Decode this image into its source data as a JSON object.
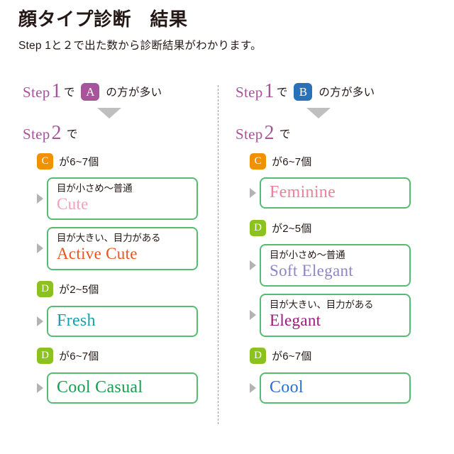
{
  "header": {
    "title": "顔タイプ診断　結果",
    "subtitle": "Step 1と２で出た数から診断結果がわかります。"
  },
  "colors": {
    "step_label": "#a8549a",
    "badge_a": "#a8549a",
    "badge_b": "#2a72b8",
    "badge_c": "#f29100",
    "badge_d": "#8cc220",
    "box_border": "#57bb72",
    "divider": "#9a9a9a",
    "arrow": "#bfbfbf",
    "marker": "#b3b3b3",
    "text": "#231815"
  },
  "columns": [
    {
      "id": "left",
      "step1": {
        "step_word": "Step",
        "step_num": "1",
        "de": "で",
        "badge": "A",
        "tail": "の方が多い"
      },
      "arrow_icon": "triangle-down-icon",
      "step2": {
        "step_word": "Step",
        "step_num": "2",
        "de": "で"
      },
      "groups": [
        {
          "badge": "C",
          "badge_kind": "c",
          "count_text": "が6~7個",
          "results": [
            {
              "note": "目が小さめ〜普通",
              "title": "Cute",
              "color": "#f2a0bd",
              "layout": "note"
            },
            {
              "note": "目が大きい、目力がある",
              "title": "Active Cute",
              "color": "#e8541e",
              "layout": "note"
            }
          ]
        },
        {
          "badge": "D",
          "badge_kind": "d",
          "count_text": "が2~5個",
          "results": [
            {
              "note": "",
              "title": "Fresh",
              "color": "#1a9fa8",
              "layout": "single"
            }
          ]
        },
        {
          "badge": "D",
          "badge_kind": "d",
          "count_text": "が6~7個",
          "results": [
            {
              "note": "",
              "title": "Cool Casual",
              "color": "#1a9d4e",
              "layout": "single"
            }
          ]
        }
      ]
    },
    {
      "id": "right",
      "step1": {
        "step_word": "Step",
        "step_num": "1",
        "de": "で",
        "badge": "B",
        "tail": "の方が多い"
      },
      "arrow_icon": "triangle-down-icon",
      "step2": {
        "step_word": "Step",
        "step_num": "2",
        "de": "で"
      },
      "groups": [
        {
          "badge": "C",
          "badge_kind": "c",
          "count_text": "が6~7個",
          "results": [
            {
              "note": "",
              "title": "Feminine",
              "color": "#ef8098",
              "layout": "single"
            }
          ]
        },
        {
          "badge": "D",
          "badge_kind": "d",
          "count_text": "が2~5個",
          "results": [
            {
              "note": "目が小さめ〜普通",
              "title": "Soft Elegant",
              "color": "#8b86c4",
              "layout": "note"
            },
            {
              "note": "目が大きい、目力がある",
              "title": "Elegant",
              "color": "#9c1a7c",
              "layout": "note"
            }
          ]
        },
        {
          "badge": "D",
          "badge_kind": "d",
          "count_text": "が6~7個",
          "results": [
            {
              "note": "",
              "title": "Cool",
              "color": "#2a6fd0",
              "layout": "single"
            }
          ]
        }
      ]
    }
  ]
}
